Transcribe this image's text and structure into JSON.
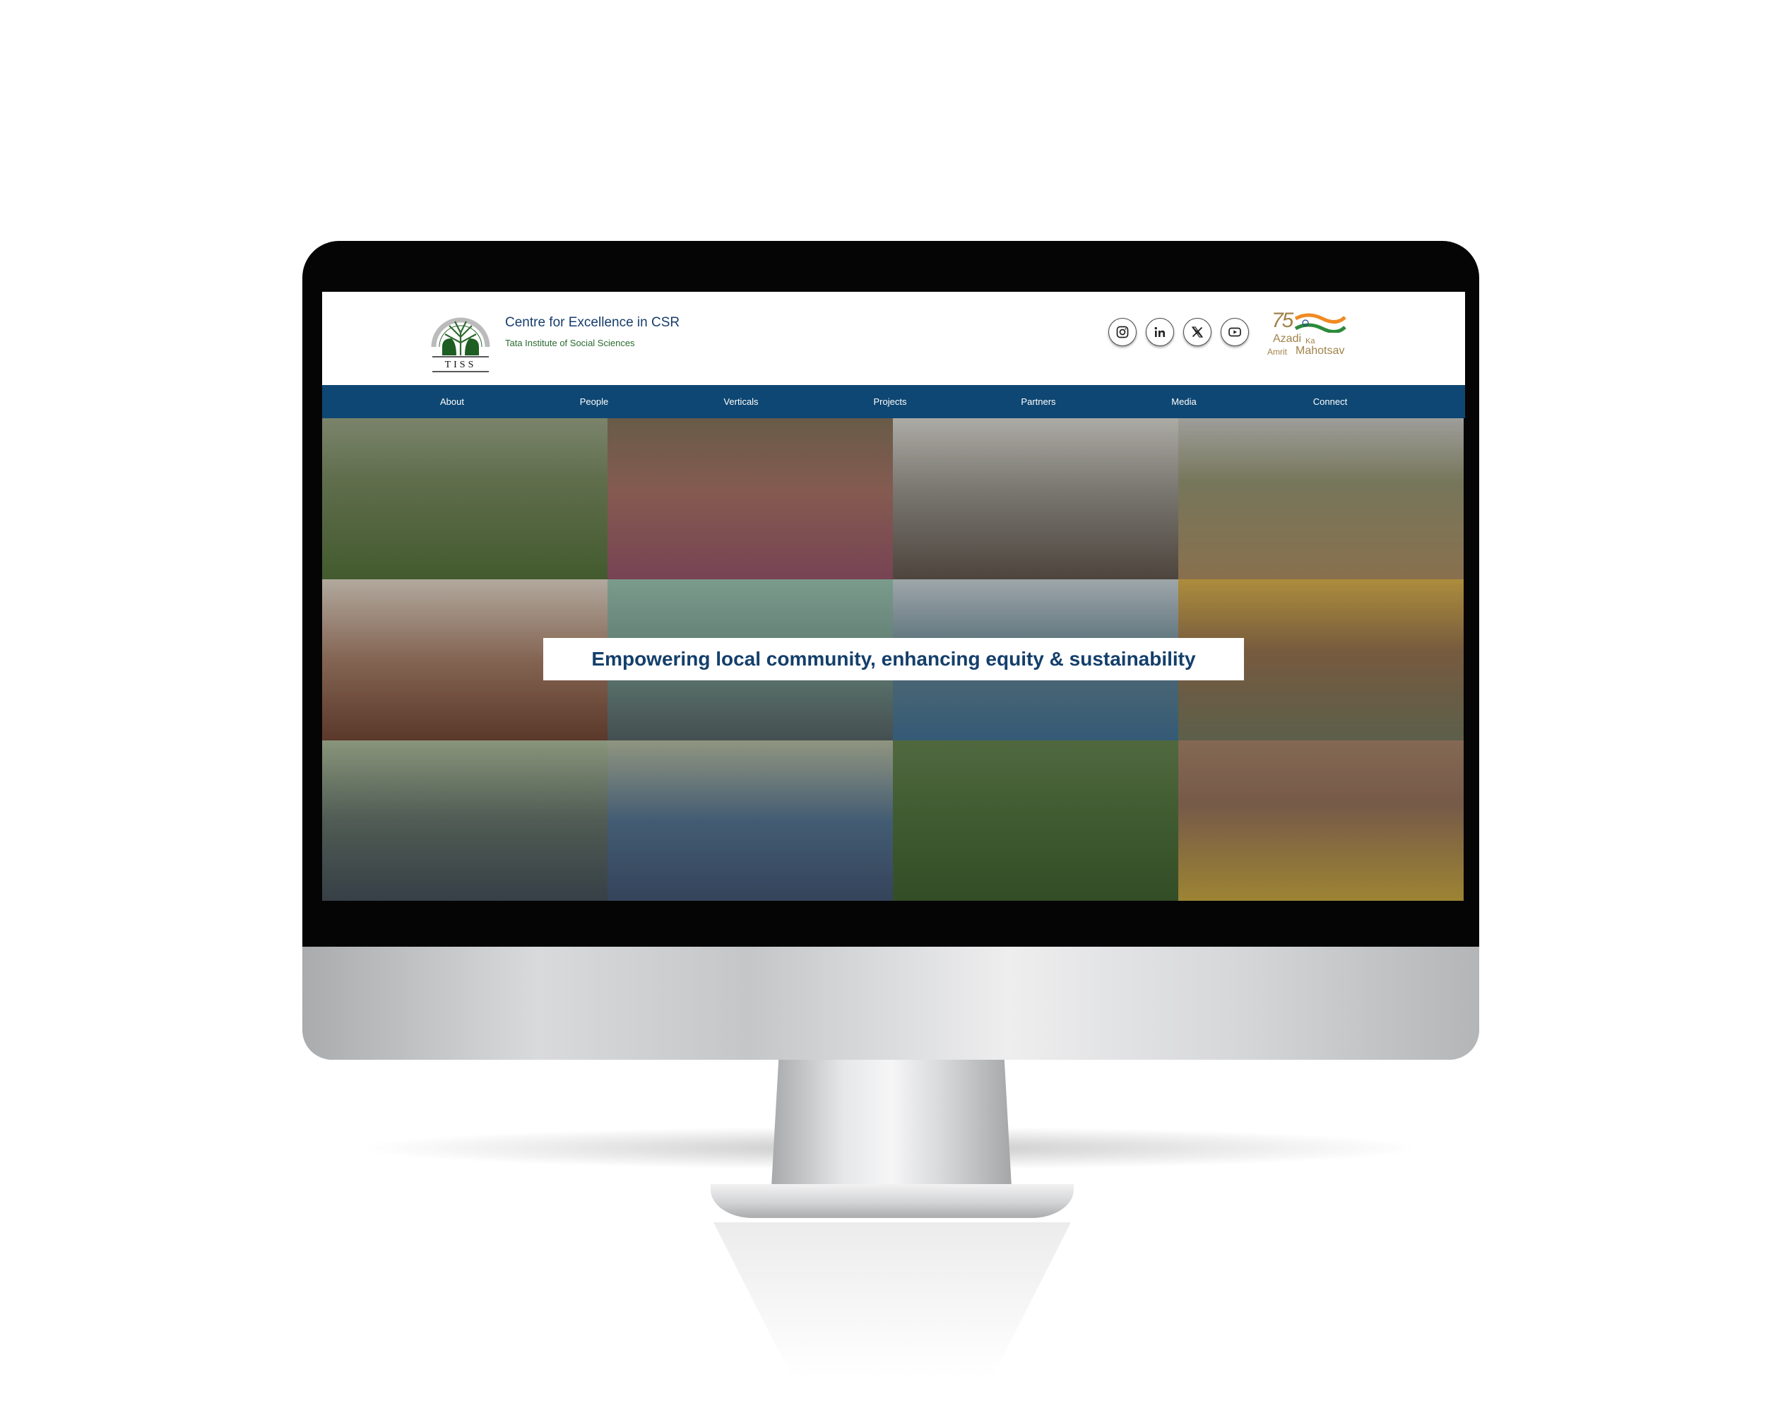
{
  "header": {
    "title": "Centre for Excellence in CSR",
    "subtitle": "Tata Institute of Social Sciences",
    "logo": {
      "acronym": "TISS",
      "arc_text": "RE-IMAGINING FUTURES",
      "hindi_text": "समाज की पुनर्कल्पना"
    },
    "social": [
      {
        "name": "Instagram",
        "icon": "instagram-icon"
      },
      {
        "name": "LinkedIn",
        "icon": "linkedin-icon"
      },
      {
        "name": "X",
        "icon": "x-icon"
      },
      {
        "name": "YouTube",
        "icon": "youtube-icon"
      }
    ],
    "badge": {
      "number": "75",
      "line1": "Azadi",
      "ka": "Ka",
      "amrit": "Amrit",
      "line2": "Mahotsav"
    }
  },
  "nav": {
    "items": [
      "About",
      "People",
      "Verticals",
      "Projects",
      "Partners",
      "Media",
      "Connect"
    ]
  },
  "hero": {
    "tagline": "Empowering local community, enhancing equity & sustainability"
  },
  "colors": {
    "nav_bg": "#0e4773",
    "brand_blue": "#173d6b",
    "brand_green": "#2b6a2f",
    "tagline_text": "#143f6b"
  }
}
